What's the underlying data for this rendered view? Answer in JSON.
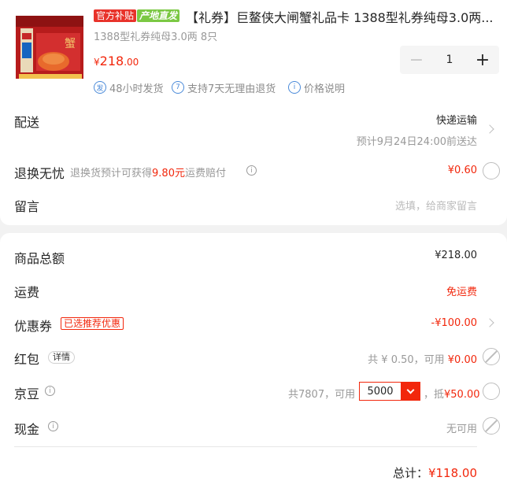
{
  "product": {
    "badge_official": "官方补贴",
    "badge_origin": "产地直发",
    "title": "【礼券】巨鳌侠大闸蟹礼品卡 1388型礼券纯母3.0两...",
    "spec": "1388型礼券纯母3.0两 8只",
    "price_symbol": "¥",
    "price_int": "218",
    "price_dec": ".00",
    "quantity": "1"
  },
  "services": [
    {
      "icon": "shipping-badge-icon",
      "icon_text": "发",
      "label": "48小时发货"
    },
    {
      "icon": "seven-day-icon",
      "icon_text": "7",
      "label": "支持7天无理由退货"
    },
    {
      "icon": "info-icon",
      "icon_text": "i",
      "label": "价格说明"
    }
  ],
  "delivery": {
    "label": "配送",
    "method": "快递运输",
    "eta": "预计9月24日24:00前送达"
  },
  "return_worry_free": {
    "label": "退换无忧",
    "desc_prefix": "退换货预计可获得",
    "desc_amount": "9.80元",
    "desc_suffix": "运费赔付",
    "price": "¥0.60"
  },
  "message": {
    "label": "留言",
    "placeholder": "选填，给商家留言"
  },
  "summary": {
    "goods_total_label": "商品总额",
    "goods_total": "¥218.00",
    "shipping_label": "运费",
    "shipping_value": "免运费",
    "coupon_label": "优惠券",
    "coupon_tag": "已选推荐优惠",
    "coupon_value": "-¥100.00",
    "redpacket_label": "红包",
    "redpacket_detail": "详情",
    "redpacket_total": "共 ¥ 0.50，可用 ",
    "redpacket_usable": "¥0.00",
    "jingdou_label": "京豆",
    "jingdou_total": "共7807，可用",
    "jingdou_select": "5000",
    "jingdou_sep": "，抵",
    "jingdou_deduct": "¥50.00",
    "cash_label": "现金",
    "cash_value": "无可用",
    "total_label": "总计：",
    "total_value": "¥118.00"
  },
  "colors": {
    "accent": "#f2270c",
    "link_blue": "#4a8ad9",
    "badge_green": "#7bc843"
  }
}
